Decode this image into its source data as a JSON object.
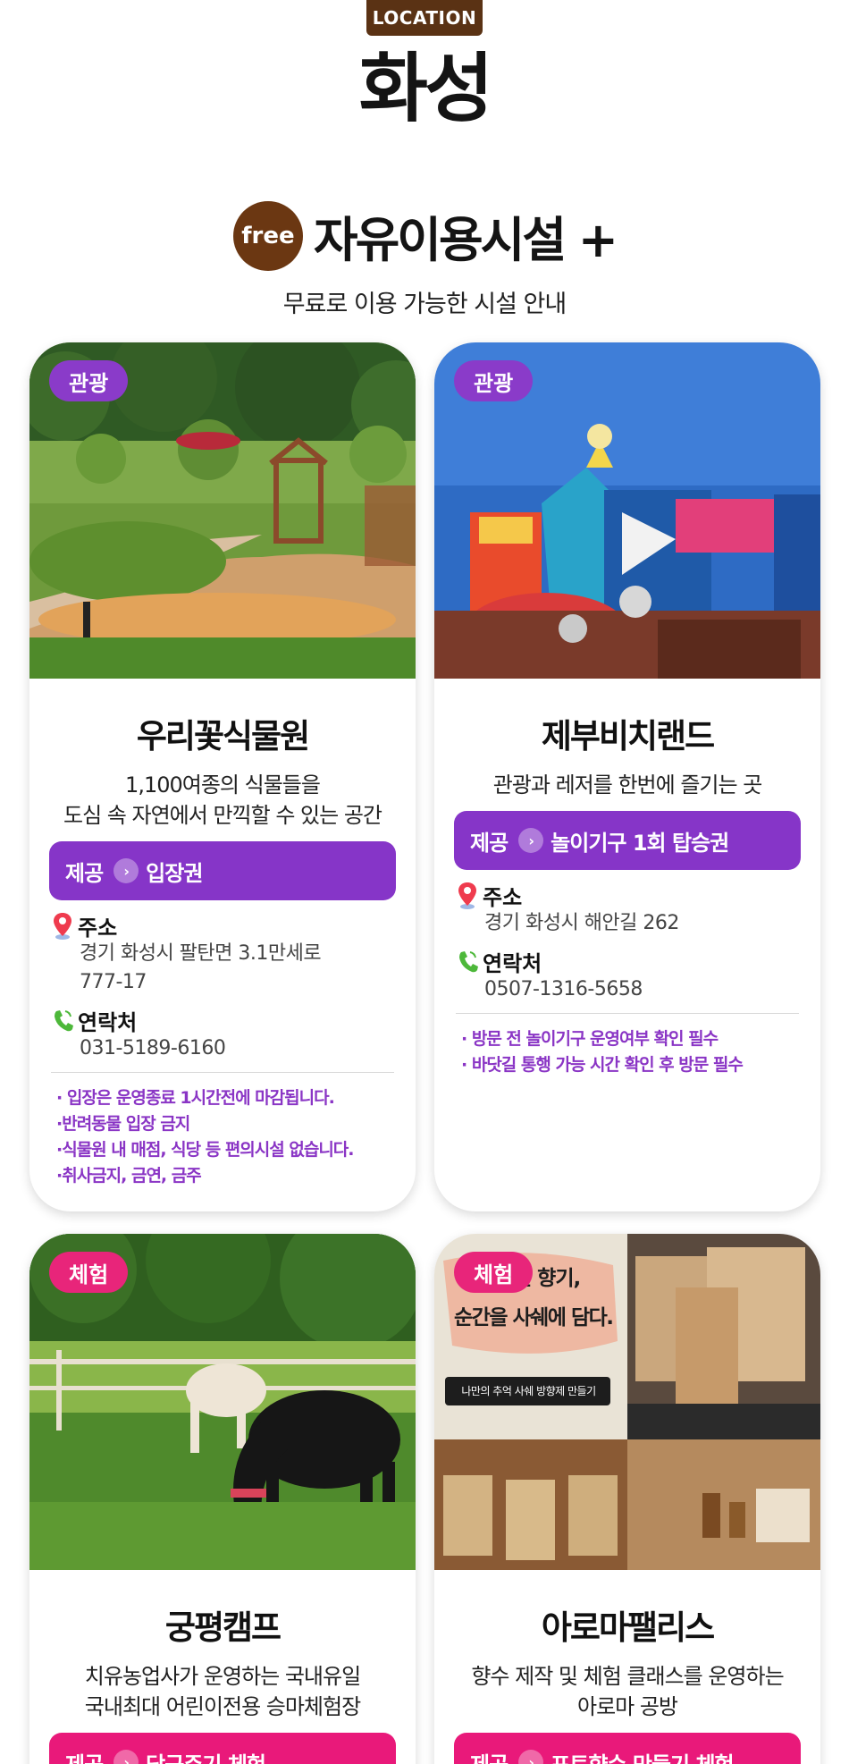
{
  "header": {
    "badge": "LOCATION",
    "city": "화성"
  },
  "section": {
    "free_label": "free",
    "title": "자유이용시설 +",
    "subtitle": "무료로 이용 가능한 시설 안내"
  },
  "common": {
    "provide_label": "제공",
    "address_label": "주소",
    "contact_label": "연락처"
  },
  "cards": [
    {
      "tag": "관광",
      "name": "우리꽃식물원",
      "desc": [
        "1,100여종의 식물들을",
        "도심 속 자연에서 만끽할 수 있는 공간"
      ],
      "provide": "입장권",
      "address": [
        "경기 화성시 팔탄면 3.1만세로",
        "777-17"
      ],
      "phone": "031-5189-6160",
      "notes": [
        "· 입장은 운영종료 1시간전에 마감됩니다.",
        "·반려동물 입장 금지",
        "·식물원 내 매점, 식당 등 편의시설 없습니다.",
        "·취사금지, 금연, 금주"
      ]
    },
    {
      "tag": "관광",
      "name": "제부비치랜드",
      "desc": [
        "관광과 레저를 한번에 즐기는 곳"
      ],
      "provide": "놀이기구 1회 탑승권",
      "address": [
        "경기 화성시 해안길 262"
      ],
      "phone": "0507-1316-5658",
      "notes": [
        "· 방문 전 놀이기구 운영여부 확인 필수",
        "· 바닷길 통행 가능 시간 확인 후 방문 필수"
      ]
    },
    {
      "tag": "체험",
      "name": "궁평캠프",
      "desc": [
        "치유농업사가 운영하는 국내유일",
        "국내최대 어린이전용 승마체험장"
      ],
      "provide": "당근주기 체험"
    },
    {
      "tag": "체험",
      "name": "아로마팰리스",
      "desc": [
        "향수 제작 및 체험 클래스를 운영하는",
        "아로마 공방"
      ],
      "provide": "포토향수 만들기 체험",
      "photo_text": {
        "line1": "진 향기,",
        "line2": "순간을 사쉐에 담다.",
        "caption": "나만의 추억 사쉐 방향제 만들기"
      }
    }
  ],
  "colors": {
    "brown": "#5a3214",
    "purple": "#8635c8",
    "pink": "#e9197a"
  }
}
